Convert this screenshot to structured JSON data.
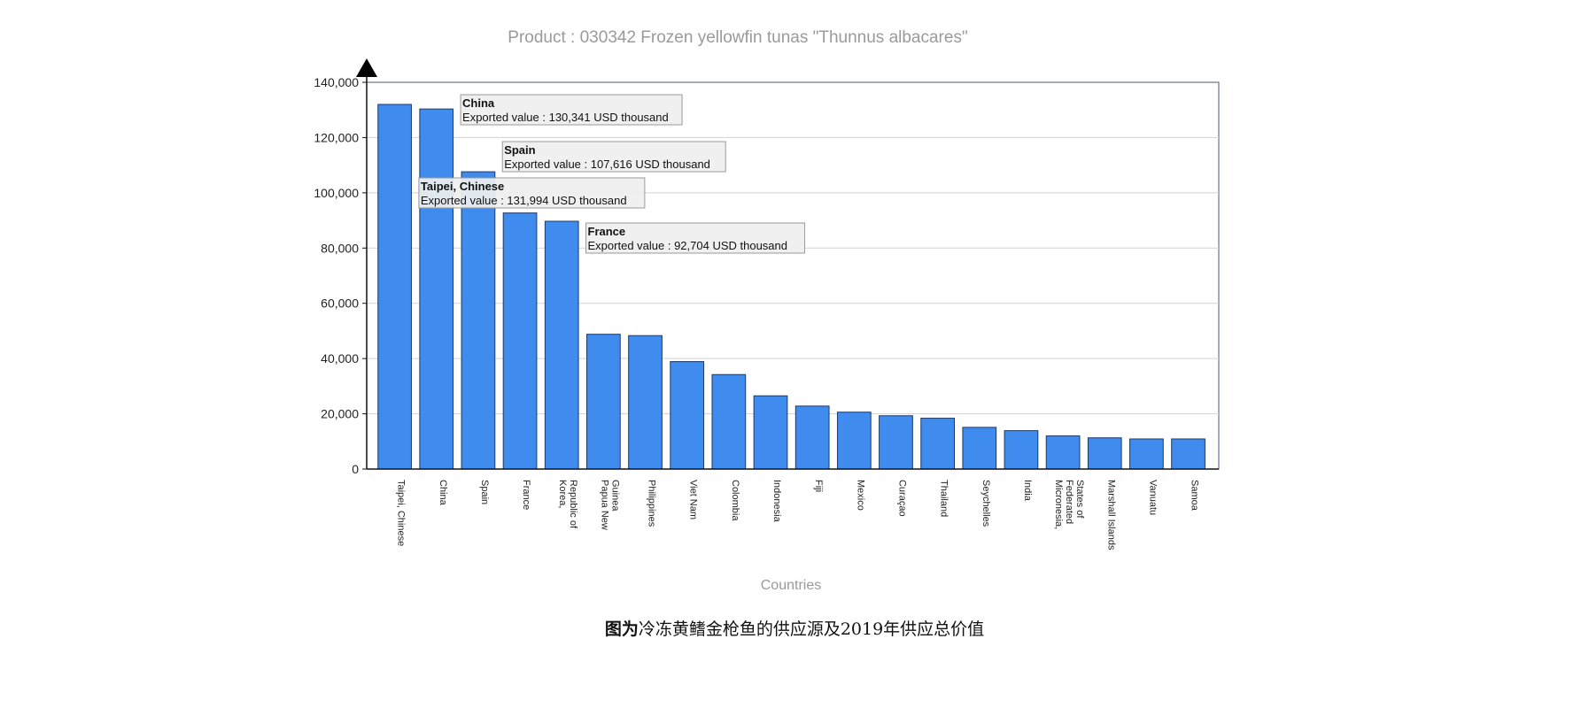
{
  "chart_data": {
    "type": "bar",
    "title": "Product : 030342 Frozen yellowfin tunas \"Thunnus albacares\"",
    "xlabel": "Countries",
    "ylabel": "",
    "ylim": [
      0,
      140000
    ],
    "yticks": [
      0,
      20000,
      40000,
      60000,
      80000,
      100000,
      120000,
      140000
    ],
    "ytick_labels": [
      "0",
      "20,000",
      "40,000",
      "60,000",
      "80,000",
      "100,000",
      "120,000",
      "140,000"
    ],
    "grid": true,
    "bar_color": "#3f8bee",
    "categories": [
      [
        "Taipei, Chinese"
      ],
      [
        "China"
      ],
      [
        "Spain"
      ],
      [
        "France"
      ],
      [
        "Korea,",
        "Republic of"
      ],
      [
        "Papua New",
        "Guinea"
      ],
      [
        "Philippines"
      ],
      [
        "Viet Nam"
      ],
      [
        "Colombia"
      ],
      [
        "Indonesia"
      ],
      [
        "Fiji"
      ],
      [
        "Mexico"
      ],
      [
        "Curaçao"
      ],
      [
        "Thailand"
      ],
      [
        "Seychelles"
      ],
      [
        "India"
      ],
      [
        "Micronesia,",
        "Federated",
        "States of"
      ],
      [
        "Marshall Islands"
      ],
      [
        "Vanuatu"
      ],
      [
        "Samoa"
      ]
    ],
    "values": [
      131994,
      130341,
      107616,
      92704,
      89700,
      48800,
      48300,
      38900,
      34200,
      26500,
      22800,
      20600,
      19300,
      18400,
      15100,
      13900,
      12000,
      11300,
      10900,
      10900
    ],
    "tooltips": [
      {
        "title": "China",
        "text": "Exported value : 130,341 USD thousand"
      },
      {
        "title": "Spain",
        "text": "Exported value : 107,616 USD thousand"
      },
      {
        "title": "Taipei, Chinese",
        "text": "Exported value : 131,994 USD thousand"
      },
      {
        "title": "France",
        "text": "Exported value : 92,704 USD thousand"
      }
    ]
  },
  "caption": {
    "bold": "图为",
    "rest": "冷冻黄鳍金枪鱼的供应源及2019年供应总价值"
  }
}
